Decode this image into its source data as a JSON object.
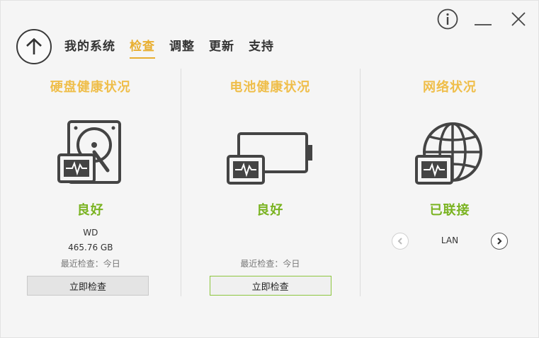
{
  "nav": {
    "tabs": [
      {
        "label": "我的系统"
      },
      {
        "label": "检查"
      },
      {
        "label": "调整"
      },
      {
        "label": "更新"
      },
      {
        "label": "支持"
      }
    ],
    "active_tab": 1
  },
  "panels": {
    "disk": {
      "title": "硬盘健康状况",
      "status": "良好",
      "vendor": "WD",
      "size": "465.76 GB",
      "last_check": "最近检查：今日",
      "button": "立即检查"
    },
    "battery": {
      "title": "电池健康状况",
      "status": "良好",
      "last_check": "最近检查：今日",
      "button": "立即检查"
    },
    "network": {
      "title": "网络状况",
      "status": "已联接",
      "connection": "LAN"
    }
  },
  "colors": {
    "accent": "#e8ae2f",
    "title": "#efbe4a",
    "ok": "#7ab321",
    "button_highlight": "#8dc63f"
  },
  "icons": [
    "info-icon",
    "minimize-icon",
    "close-icon",
    "arrow-up-icon",
    "hard-drive-icon",
    "battery-icon",
    "globe-icon",
    "chevron-left-icon",
    "chevron-right-icon"
  ]
}
